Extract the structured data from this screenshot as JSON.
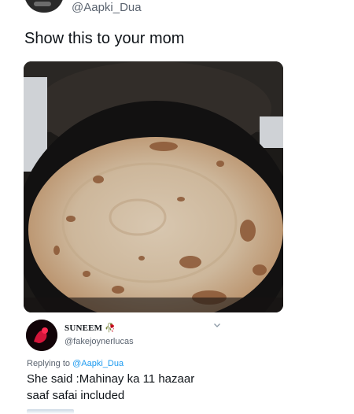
{
  "tweet": {
    "handle": "@Aapki_Dua",
    "text": "Show this to your mom"
  },
  "reply": {
    "name": "SUNEEM",
    "name_suffix": "🥀",
    "handle": "@fakejoynerlucas",
    "replying_prefix": "Replying to ",
    "replying_to": "@Aapki_Dua",
    "line1": "She said :Mahinay ka 11 hazaar",
    "line2": "saaf safai included"
  },
  "colors": {
    "muted": "#5b6470",
    "link": "#1d9bf0",
    "text": "#0f1419"
  }
}
